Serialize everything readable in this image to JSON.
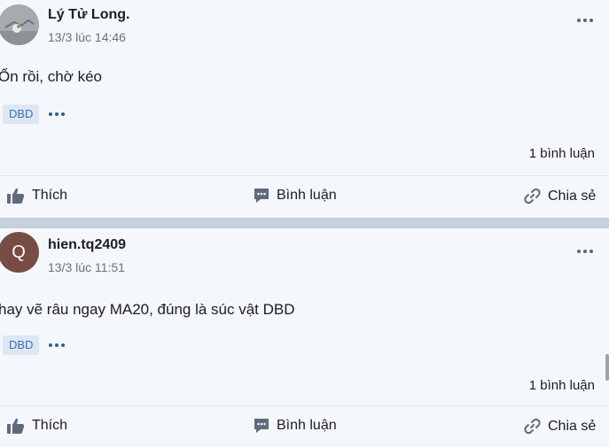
{
  "posts": [
    {
      "author": "Lý Tử Long.",
      "time": "13/3 lúc 14:46",
      "content": "Ổn rồi, chờ kéo",
      "tag": "DBD",
      "comments_count": "1 bình luận",
      "avatar_letter": ""
    },
    {
      "author": "hien.tq2409",
      "time": "13/3 lúc 11:51",
      "content": "hay vẽ râu ngay MA20, đúng là súc vật DBD",
      "tag": "DBD",
      "comments_count": "1 bình luận",
      "avatar_letter": "Q"
    }
  ],
  "actions": {
    "like_label": "Thích",
    "comment_label": "Bình luận",
    "share_label": "Chia sẻ"
  },
  "colors": {
    "background": "#f4f7fb",
    "separator": "#c5d0dc",
    "tag_bg": "#dde7f3",
    "tag_text": "#3a6fb0",
    "avatar2_bg": "#774c45"
  },
  "icons": {
    "like": "thumbs-up-icon",
    "comment": "comment-icon",
    "share": "link-icon",
    "more": "more-dots-icon"
  }
}
